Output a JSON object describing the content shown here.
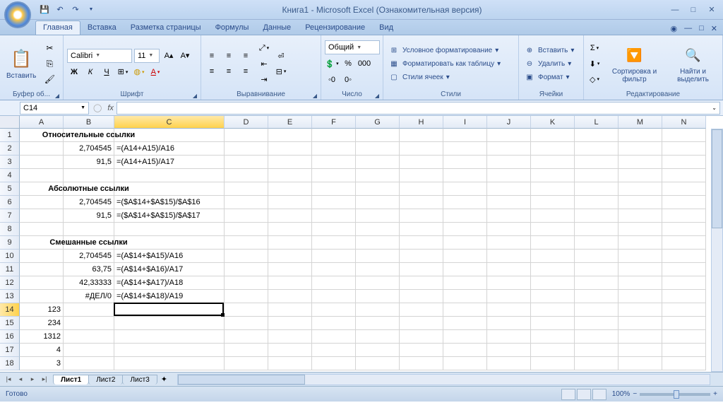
{
  "title": "Книга1 - Microsoft Excel (Ознакомительная версия)",
  "tabs": [
    "Главная",
    "Вставка",
    "Разметка страницы",
    "Формулы",
    "Данные",
    "Рецензирование",
    "Вид"
  ],
  "ribbon": {
    "clipboard": {
      "paste": "Вставить",
      "label": "Буфер об..."
    },
    "font": {
      "name": "Calibri",
      "size": "11",
      "label": "Шрифт"
    },
    "alignment": {
      "label": "Выравнивание"
    },
    "number": {
      "format": "Общий",
      "label": "Число"
    },
    "styles": {
      "cond": "Условное форматирование",
      "table": "Форматировать как таблицу",
      "cell": "Стили ячеек",
      "label": "Стили"
    },
    "cells": {
      "insert": "Вставить",
      "delete": "Удалить",
      "format": "Формат",
      "label": "Ячейки"
    },
    "editing": {
      "sort": "Сортировка и фильтр",
      "find": "Найти и выделить",
      "label": "Редактирование"
    }
  },
  "namebox": "C14",
  "columns": [
    "A",
    "B",
    "C",
    "D",
    "E",
    "F",
    "G",
    "H",
    "I",
    "J",
    "K",
    "L",
    "M",
    "N"
  ],
  "colWidths": {
    "A": 62,
    "B": 72,
    "C": 156,
    "default": 62
  },
  "rows": [
    1,
    2,
    3,
    4,
    5,
    6,
    7,
    8,
    9,
    10,
    11,
    12,
    13,
    14,
    15,
    16,
    17,
    18
  ],
  "cells": {
    "1": {
      "B": {
        "v": "Относительные ссылки",
        "span": 2,
        "align": "c",
        "bold": true
      }
    },
    "2": {
      "B": {
        "v": "2,704545",
        "align": "r"
      },
      "C": {
        "v": "=(A14+A15)/A16"
      }
    },
    "3": {
      "B": {
        "v": "91,5",
        "align": "r"
      },
      "C": {
        "v": "=(A14+A15)/A17"
      }
    },
    "5": {
      "B": {
        "v": "Абсолютные ссылки",
        "span": 2,
        "align": "c",
        "bold": true
      }
    },
    "6": {
      "B": {
        "v": "2,704545",
        "align": "r"
      },
      "C": {
        "v": "=($A$14+$A$15)/$A$16"
      }
    },
    "7": {
      "B": {
        "v": "91,5",
        "align": "r"
      },
      "C": {
        "v": "=($A$14+$A$15)/$A$17"
      }
    },
    "9": {
      "B": {
        "v": "Смешанные ссылки",
        "span": 2,
        "align": "c",
        "bold": true
      }
    },
    "10": {
      "B": {
        "v": "2,704545",
        "align": "r"
      },
      "C": {
        "v": "=(A$14+$A15)/A16"
      }
    },
    "11": {
      "B": {
        "v": "63,75",
        "align": "r"
      },
      "C": {
        "v": "=(A$14+$A16)/A17"
      }
    },
    "12": {
      "B": {
        "v": "42,33333",
        "align": "r"
      },
      "C": {
        "v": "=(A$14+$A17)/A18"
      }
    },
    "13": {
      "B": {
        "v": "#ДЕЛ/0",
        "align": "r"
      },
      "C": {
        "v": "=(A$14+$A18)/A19"
      }
    },
    "14": {
      "A": {
        "v": "123",
        "align": "r"
      }
    },
    "15": {
      "A": {
        "v": "234",
        "align": "r"
      }
    },
    "16": {
      "A": {
        "v": "1312",
        "align": "r"
      }
    },
    "17": {
      "A": {
        "v": "4",
        "align": "r"
      }
    },
    "18": {
      "A": {
        "v": "3",
        "align": "r"
      }
    }
  },
  "activeCell": "C14",
  "sheets": [
    "Лист1",
    "Лист2",
    "Лист3"
  ],
  "status": "Готово",
  "zoom": "100%"
}
